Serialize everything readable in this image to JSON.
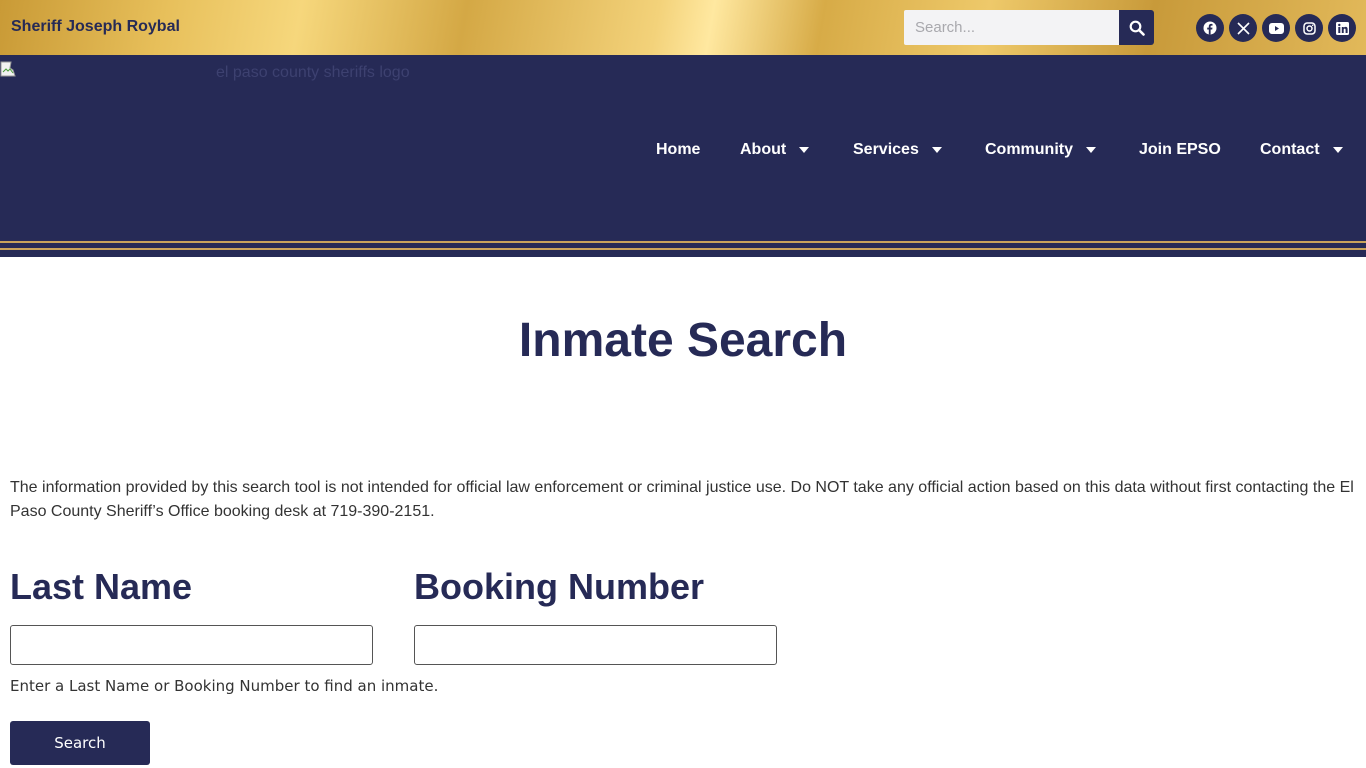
{
  "topbar": {
    "sheriff_name": "Sheriff Joseph Roybal",
    "search_placeholder": "Search...",
    "social_icons": [
      "facebook-icon",
      "x-twitter-icon",
      "youtube-icon",
      "instagram-icon",
      "linkedin-icon"
    ]
  },
  "header": {
    "logo_alt": "el paso county sheriffs logo",
    "nav": [
      {
        "label": "Home",
        "has_dropdown": false
      },
      {
        "label": "About",
        "has_dropdown": true
      },
      {
        "label": "Services",
        "has_dropdown": true
      },
      {
        "label": "Community",
        "has_dropdown": true
      },
      {
        "label": "Join EPSO",
        "has_dropdown": false
      },
      {
        "label": "Contact",
        "has_dropdown": true
      }
    ]
  },
  "main": {
    "title": "Inmate Search",
    "disclaimer": "The information provided by this search tool is not intended for official law enforcement or criminal justice use. Do NOT take any official action based on this data without first contacting the El Paso County Sheriff’s Office booking desk at 719-390-2151.",
    "last_name_label": "Last Name",
    "last_name_value": "",
    "booking_number_label": "Booking Number",
    "booking_number_value": "",
    "hint": "Enter a Last Name or Booking Number to find an inmate.",
    "search_button": "Search"
  },
  "colors": {
    "navy": "#262a56",
    "gold": "#c9a35b",
    "text": "#333333"
  }
}
